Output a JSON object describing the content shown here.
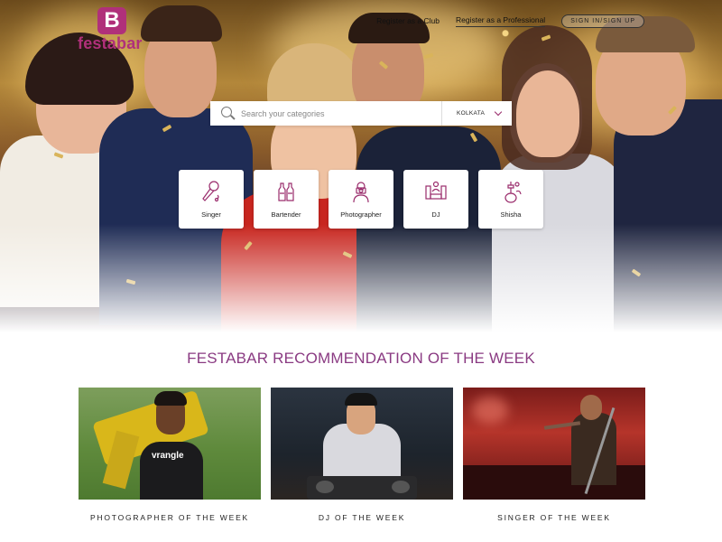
{
  "brand": {
    "logo_letter": "B",
    "name": "festabar",
    "color": "#b0307a"
  },
  "nav": {
    "register_club": "Register as a Club",
    "register_professional": "Register as a Professional",
    "signin": "SIGN IN/SIGN UP"
  },
  "search": {
    "placeholder": "Search your categories",
    "city": "KOLKATA",
    "icon": "search-icon"
  },
  "categories": [
    {
      "label": "Singer",
      "icon": "microphone-icon"
    },
    {
      "label": "Bartender",
      "icon": "bottles-icon"
    },
    {
      "label": "Photographer",
      "icon": "photographer-icon"
    },
    {
      "label": "DJ",
      "icon": "dj-console-icon"
    },
    {
      "label": "Shisha",
      "icon": "hookah-icon"
    }
  ],
  "recommendation": {
    "title": "FESTABAR RECOMMENDATION OF THE WEEK",
    "cards": [
      {
        "caption": "PHOTOGRAPHER OF THE WEEK"
      },
      {
        "caption": "DJ OF THE WEEK"
      },
      {
        "caption": "SINGER OF THE WEEK"
      }
    ],
    "shirt_text": "vrangle"
  },
  "colors": {
    "accent": "#8a3a82",
    "icon_stroke": "#9a2c6c"
  }
}
